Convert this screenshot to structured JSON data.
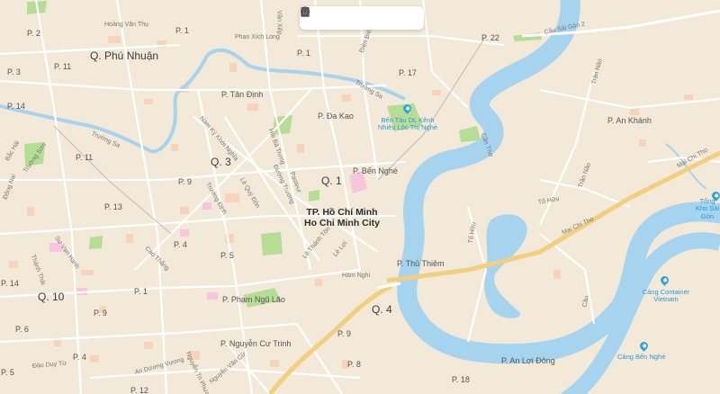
{
  "colors": {
    "land": "#f3e9d8",
    "water": "#a6d3ee",
    "park": "#b5dd95",
    "major_road": "#f2cf7e",
    "road": "#ffffff",
    "block": "#f6d3b9",
    "pink": "#f7c6dc",
    "poi": "#2aa5e0"
  },
  "toolbar": {
    "buttons": [
      {
        "icon": "share-icon"
      },
      {
        "icon": "book-icon"
      },
      {
        "icon": "gear-icon"
      },
      {
        "icon": "palette-icon"
      },
      {
        "icon": "download-icon"
      },
      {
        "icon": "location-pin-icon"
      }
    ]
  },
  "labels": {
    "districts": [
      "Q. Phú Nhuận",
      "Q. 3",
      "Q. 1",
      "Q. 10",
      "Q. 4"
    ],
    "city": [
      "TP. Hồ Chí Minh",
      "Ho Chi Minh City"
    ],
    "wards": [
      "P. 1",
      "P. 2",
      "P. 22",
      "P. 3",
      "P. 1",
      "P. 11",
      "P. 17",
      "P. Tân Định",
      "P. Đa Kao",
      "P. An Khánh",
      "P. 14",
      "P. 11",
      "P. Bến Nghé",
      "P. 9",
      "P. 13",
      "P. 4",
      "P. 5",
      "P. 14",
      "P. 1",
      "P. Thủ Thiêm",
      "P. Phạm Ngũ Lão",
      "P. 6",
      "P. 9",
      "P. Nguyễn Cư Trinh",
      "P. 4",
      "P. 9",
      "P. 8",
      "P. 18",
      "P. An Lợi Đông",
      "P. 5",
      "P. 12"
    ],
    "streets": [
      "Hoàng Văn Thụ",
      "Văn Xếp",
      "Phan Xích Long",
      "Điện Biên Phủ",
      "Cầu Sài Gòn 2",
      "Trần Não",
      "Trường Sa",
      "Trường Sa",
      "Nam Kỳ Khởi Nghĩa",
      "Hai Bà Trưng",
      "Cần Thơ",
      "Bắc Hải",
      "Trường Sơn",
      "Đồng Nai",
      "Trương Định",
      "Lê Quý Đôn",
      "Pasteur",
      "Đường Trường",
      "Trần Não",
      "Mai Chí Thọ",
      "Tố Hữu",
      "Sư Vạn Hạnh",
      "Thành Thái",
      "Cao Thắng",
      "Lê Thánh Tôn",
      "Lê Lợi",
      "Hàm Nghi",
      "Tố Hữu",
      "Cầu",
      "An Dương Vương",
      "Nguyễn Tri Phương",
      "Đào Duy Từ",
      "Nguyễn Văn Cừ",
      "Mai Chí Thọ"
    ],
    "pois": [
      "Bến Tàu DL Kênh Nhiêu Lộc Thị Nghè",
      "Cảng Container Vietnam",
      "Cảng Bến Nghé",
      "Tổng Kho Sài Gòn"
    ]
  }
}
